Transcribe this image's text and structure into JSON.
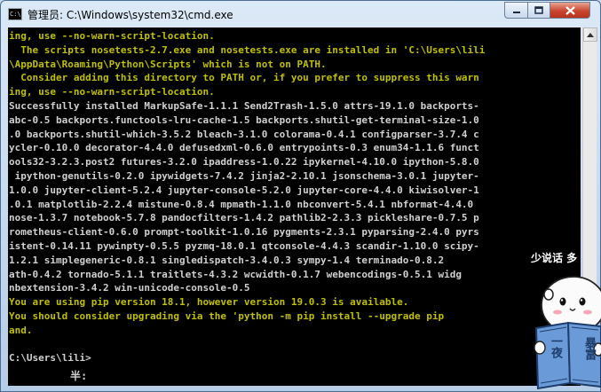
{
  "window": {
    "title": "管理员: C:\\Windows\\system32\\cmd.exe",
    "icon": "cmd-icon",
    "controls": {
      "minimize": "minimize-icon",
      "maximize": "maximize-icon",
      "close": "close-icon"
    }
  },
  "console": {
    "lines": [
      {
        "text": "ing, use --no-warn-script-location.",
        "color": "#c0c000"
      },
      {
        "text": "  The scripts nosetests-2.7.exe and nosetests.exe are installed in 'C:\\Users\\lili",
        "color": "#c0c000"
      },
      {
        "text": "\\AppData\\Roaming\\Python\\Scripts' which is not on PATH.",
        "color": "#c0c000"
      },
      {
        "text": "  Consider adding this directory to PATH or, if you prefer to suppress this warn",
        "color": "#c0c000"
      },
      {
        "text": "ing, use --no-warn-script-location.",
        "color": "#c0c000"
      },
      {
        "text": "Successfully installed MarkupSafe-1.1.1 Send2Trash-1.5.0 attrs-19.1.0 backports-",
        "color": "#d0d0d0"
      },
      {
        "text": "abc-0.5 backports.functools-lru-cache-1.5 backports.shutil-get-terminal-size-1.0",
        "color": "#d0d0d0"
      },
      {
        "text": ".0 backports.shutil-which-3.5.2 bleach-3.1.0 colorama-0.4.1 configparser-3.7.4 c",
        "color": "#d0d0d0"
      },
      {
        "text": "ycler-0.10.0 decorator-4.4.0 defusedxml-0.6.0 entrypoints-0.3 enum34-1.1.6 funct",
        "color": "#d0d0d0"
      },
      {
        "text": "ools32-3.2.3.post2 futures-3.2.0 ipaddress-1.0.22 ipykernel-4.10.0 ipython-5.8.0",
        "color": "#d0d0d0"
      },
      {
        "text": " ipython-genutils-0.2.0 ipywidgets-7.4.2 jinja2-2.10.1 jsonschema-3.0.1 jupyter-",
        "color": "#d0d0d0"
      },
      {
        "text": "1.0.0 jupyter-client-5.2.4 jupyter-console-5.2.0 jupyter-core-4.4.0 kiwisolver-1",
        "color": "#d0d0d0"
      },
      {
        "text": ".0.1 matplotlib-2.2.4 mistune-0.8.4 mpmath-1.1.0 nbconvert-5.4.1 nbformat-4.4.0",
        "color": "#d0d0d0"
      },
      {
        "text": "nose-1.3.7 notebook-5.7.8 pandocfilters-1.4.2 pathlib2-2.3.3 pickleshare-0.7.5 p",
        "color": "#d0d0d0"
      },
      {
        "text": "rometheus-client-0.6.0 prompt-toolkit-1.0.16 pygments-2.3.1 pyparsing-2.4.0 pyrs",
        "color": "#d0d0d0"
      },
      {
        "text": "istent-0.14.11 pywinpty-0.5.5 pyzmq-18.0.1 qtconsole-4.4.3 scandir-1.10.0 scipy-",
        "color": "#d0d0d0"
      },
      {
        "text": "1.2.1 simplegeneric-0.8.1 singledispatch-3.4.0.3 sympy-1.4 terminado-0.8.2",
        "color": "#d0d0d0"
      },
      {
        "text": "ath-0.4.2 tornado-5.1.1 traitlets-4.3.2 wcwidth-0.1.7 webencodings-0.5.1 widg",
        "color": "#d0d0d0"
      },
      {
        "text": "nbextension-3.4.2 win-unicode-console-0.5",
        "color": "#d0d0d0"
      },
      {
        "text": "You are using pip version 18.1, however version 19.0.3 is available.",
        "color": "#c0c000"
      },
      {
        "text": "You should consider upgrading via the 'python -m pip install --upgrade pip",
        "color": "#c0c000"
      },
      {
        "text": "and.",
        "color": "#c0c000"
      },
      {
        "text": "",
        "color": "#d0d0d0"
      },
      {
        "text": "C:\\Users\\lili>",
        "color": "#d0d0d0"
      }
    ],
    "ime_status": "半:"
  },
  "sticker": {
    "caption": "少说话 多",
    "book_text_1": "一夜",
    "book_text_2": "暴富"
  },
  "scrollbar": {
    "up": "scroll-up-arrow-icon",
    "down": "scroll-down-arrow-icon"
  }
}
